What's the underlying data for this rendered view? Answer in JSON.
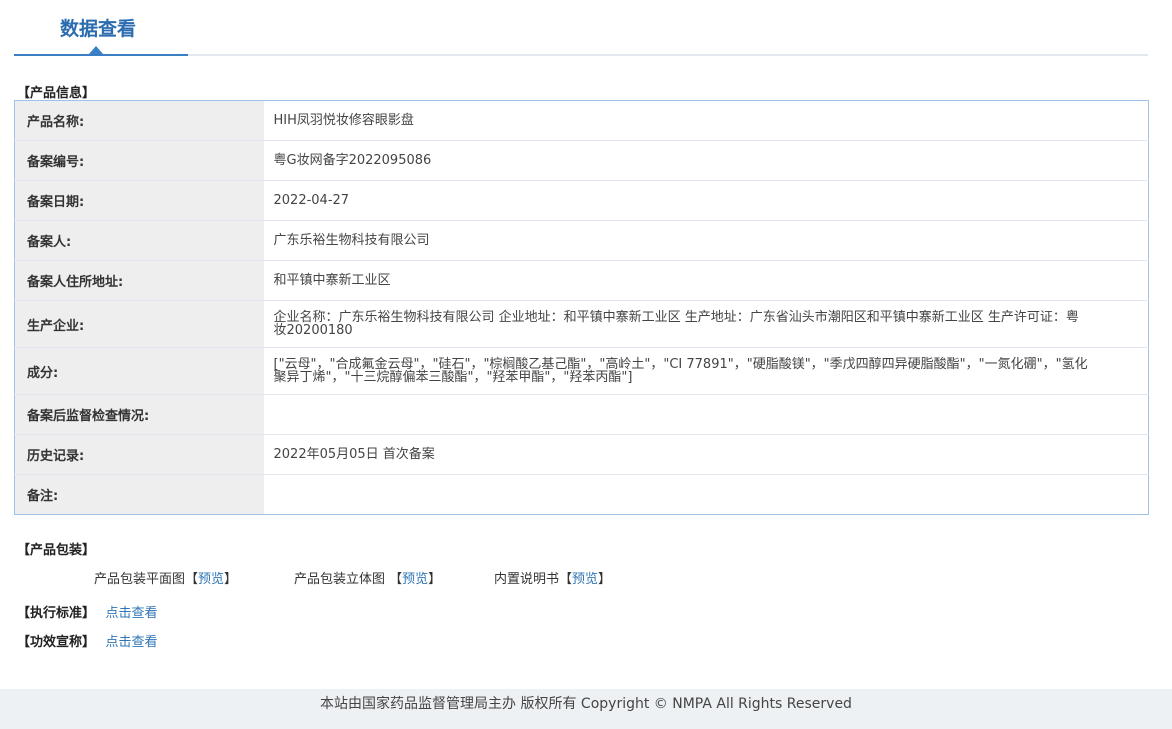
{
  "tab": {
    "title": "数据查看"
  },
  "product_info": {
    "heading": "【产品信息】",
    "rows": [
      {
        "label": "产品名称:",
        "value": "HIH凤羽悦妆修容眼影盘"
      },
      {
        "label": "备案编号:",
        "value": "粤G妆网备字2022095086"
      },
      {
        "label": "备案日期:",
        "value": "2022-04-27"
      },
      {
        "label": "备案人:",
        "value": "广东乐裕生物科技有限公司"
      },
      {
        "label": "备案人住所地址:",
        "value": "和平镇中寨新工业区"
      },
      {
        "label": "生产企业:",
        "value": "企业名称：广东乐裕生物科技有限公司 企业地址：和平镇中寨新工业区 生产地址：广东省汕头市潮阳区和平镇中寨新工业区 生产许可证：粤妆20200180"
      },
      {
        "label": "成分:",
        "value": "[\"云母\"，\"合成氟金云母\"，\"硅石\"，\"棕榈酸乙基己酯\"，\"高岭土\"，\"CI 77891\"，\"硬脂酸镁\"，\"季戊四醇四异硬脂酸酯\"，\"一氮化硼\"，\"氢化聚异丁烯\"，\"十三烷醇偏苯三酸酯\"，\"羟苯甲酯\"，\"羟苯丙酯\"]"
      },
      {
        "label": "备案后监督检查情况:",
        "value": ""
      },
      {
        "label": "历史记录:",
        "value": "2022年05月05日 首次备案"
      },
      {
        "label": "备注:",
        "value": ""
      }
    ]
  },
  "packaging": {
    "heading": "【产品包装】",
    "items": [
      {
        "label": "产品包装平面图",
        "link": "预览"
      },
      {
        "label": "产品包装立体图 ",
        "link": "预览"
      },
      {
        "label": "内置说明书",
        "link": "预览"
      }
    ]
  },
  "standard": {
    "heading": "【执行标准】",
    "link": "点击查看"
  },
  "efficacy": {
    "heading": "【功效宣称】",
    "link": "点击查看"
  },
  "footer": {
    "text": "本站由国家药品监督管理局主办 版权所有 Copyright © NMPA All Rights Reserved"
  }
}
